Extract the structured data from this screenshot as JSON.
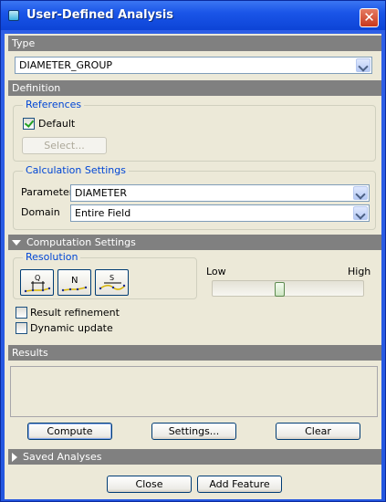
{
  "window": {
    "title": "User-Defined Analysis",
    "close_glyph": "✕"
  },
  "type_section": {
    "label": "Type",
    "value": "DIAMETER_GROUP"
  },
  "definition": {
    "label": "Definition",
    "references": {
      "legend": "References",
      "default_label": "Default",
      "default_checked": true,
      "select_label": "Select..."
    },
    "calculation": {
      "legend": "Calculation Settings",
      "parameter_label": "Parameter",
      "parameter_value": "DIAMETER",
      "domain_label": "Domain",
      "domain_value": "Entire Field"
    }
  },
  "computation": {
    "label": "Computation Settings",
    "resolution_legend": "Resolution",
    "mode_buttons": [
      {
        "name": "Q",
        "icon": "quality-sampling-icon"
      },
      {
        "name": "N",
        "icon": "number-sampling-icon"
      },
      {
        "name": "S",
        "icon": "step-sampling-icon"
      }
    ],
    "slider": {
      "low_label": "Low",
      "high_label": "High",
      "value": 0.44
    },
    "result_refinement_label": "Result refinement",
    "result_refinement_checked": false,
    "dynamic_update_label": "Dynamic update",
    "dynamic_update_checked": false
  },
  "results": {
    "label": "Results",
    "compute_label": "Compute",
    "settings_label": "Settings...",
    "clear_label": "Clear"
  },
  "saved_analyses": {
    "label": "Saved Analyses"
  },
  "footer": {
    "close_label": "Close",
    "add_feature_label": "Add Feature"
  },
  "colors": {
    "titlebar": "#0d44d6",
    "section_bar": "#808080",
    "dialog_bg": "#ece9d8",
    "legend_text": "#0046d5"
  }
}
